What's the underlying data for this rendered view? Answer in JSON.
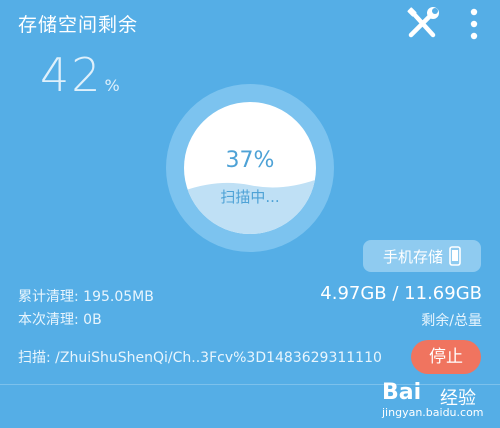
{
  "header": {
    "title": "存储空间剩余",
    "tools_icon": "wrench-screwdriver-icon",
    "more_icon": "more-vertical-icon"
  },
  "storage_remaining": {
    "value": "42",
    "unit": "%"
  },
  "scan_gauge": {
    "percent": "37%",
    "status": "扫描中...",
    "fill_fraction": 0.37
  },
  "storage_button": {
    "label": "手机存储",
    "icon": "phone-icon"
  },
  "stats": {
    "cumulative_label": "累计清理:",
    "cumulative_value": "195.05MB",
    "current_label": "本次清理:",
    "current_value": "0B"
  },
  "capacity": {
    "value": "4.97GB / 11.69GB",
    "caption": "剩余/总量"
  },
  "scan": {
    "label": "扫描:",
    "path": "/ZhuiShuShenQi/Ch..3Fcv%3D1483629311110"
  },
  "stop_button": {
    "label": "停止"
  },
  "watermark": {
    "brand": "Bai",
    "brand_suffix": "经验",
    "url": "jingyan.baidu.com"
  },
  "colors": {
    "background": "#55aee6",
    "gauge_ring": "#7cc3ef",
    "gauge_face": "#ffffff",
    "gauge_fill": "#bfe0f5",
    "stop_button": "#f0745f",
    "storage_button": "#8fcbf0"
  }
}
